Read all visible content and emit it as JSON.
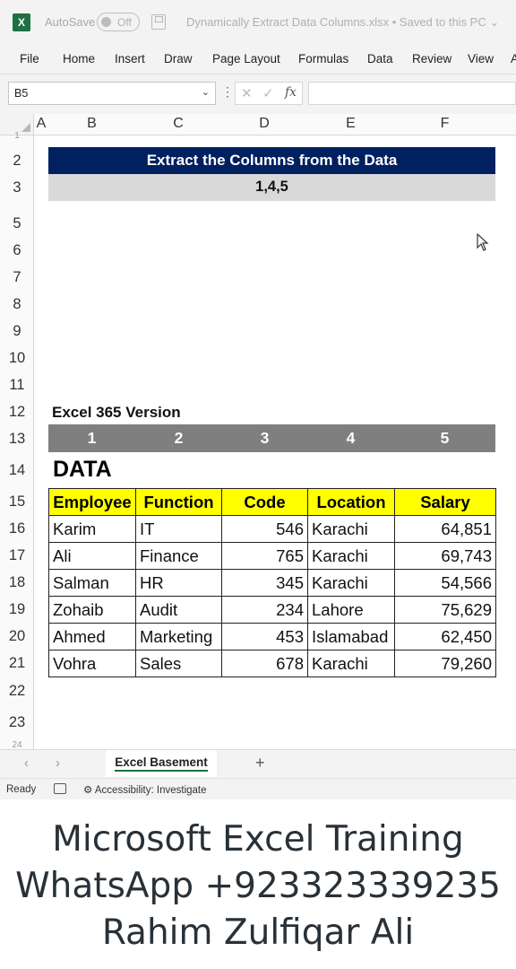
{
  "titlebar": {
    "app_icon": "X",
    "autosave_label": "AutoSave",
    "autosave_state": "Off",
    "filename": "Dynamically Extract Data Columns.xlsx",
    "saved_status": "• Saved to this PC ⌄"
  },
  "ribbon": {
    "tabs": [
      "File",
      "Home",
      "Insert",
      "Draw",
      "Page Layout",
      "Formulas",
      "Data",
      "Review",
      "View",
      "A"
    ]
  },
  "formula_bar": {
    "namebox": "B5",
    "formula": ""
  },
  "grid": {
    "columns": [
      "A",
      "B",
      "C",
      "D",
      "E",
      "F"
    ],
    "rows": [
      "1",
      "2",
      "3",
      "5",
      "6",
      "7",
      "8",
      "9",
      "10",
      "11",
      "12",
      "13",
      "14",
      "15",
      "16",
      "17",
      "18",
      "19",
      "20",
      "21",
      "22",
      "23",
      "24"
    ],
    "banner_title": "Extract the Columns from the Data",
    "banner_value": "1,4,5",
    "version_label": "Excel 365 Version",
    "column_numbers": [
      "1",
      "2",
      "3",
      "4",
      "5"
    ],
    "data_title": "DATA",
    "table": {
      "headers": [
        "Employee",
        "Function",
        "Code",
        "Location",
        "Salary"
      ],
      "rows": [
        [
          "Karim",
          "IT",
          "546",
          "Karachi",
          "64,851"
        ],
        [
          "Ali",
          "Finance",
          "765",
          "Karachi",
          "69,743"
        ],
        [
          "Salman",
          "HR",
          "345",
          "Karachi",
          "54,566"
        ],
        [
          "Zohaib",
          "Audit",
          "234",
          "Lahore",
          "75,629"
        ],
        [
          "Ahmed",
          "Marketing",
          "453",
          "Islamabad",
          "62,450"
        ],
        [
          "Vohra",
          "Sales",
          "678",
          "Karachi",
          "79,260"
        ]
      ]
    }
  },
  "sheet_tabs": {
    "active": "Excel Basement",
    "add": "+"
  },
  "status_bar": {
    "ready": "Ready",
    "accessibility": "Accessibility: Investigate"
  },
  "caption": {
    "line1": "Microsoft Excel Training",
    "line2": "WhatsApp +923323339235",
    "line3": "Rahim Zulfiqar Ali"
  },
  "colors": {
    "banner": "#002060",
    "header_fill": "#ffff00",
    "number_row": "#7f7f7f",
    "excel_green": "#1e7145"
  }
}
